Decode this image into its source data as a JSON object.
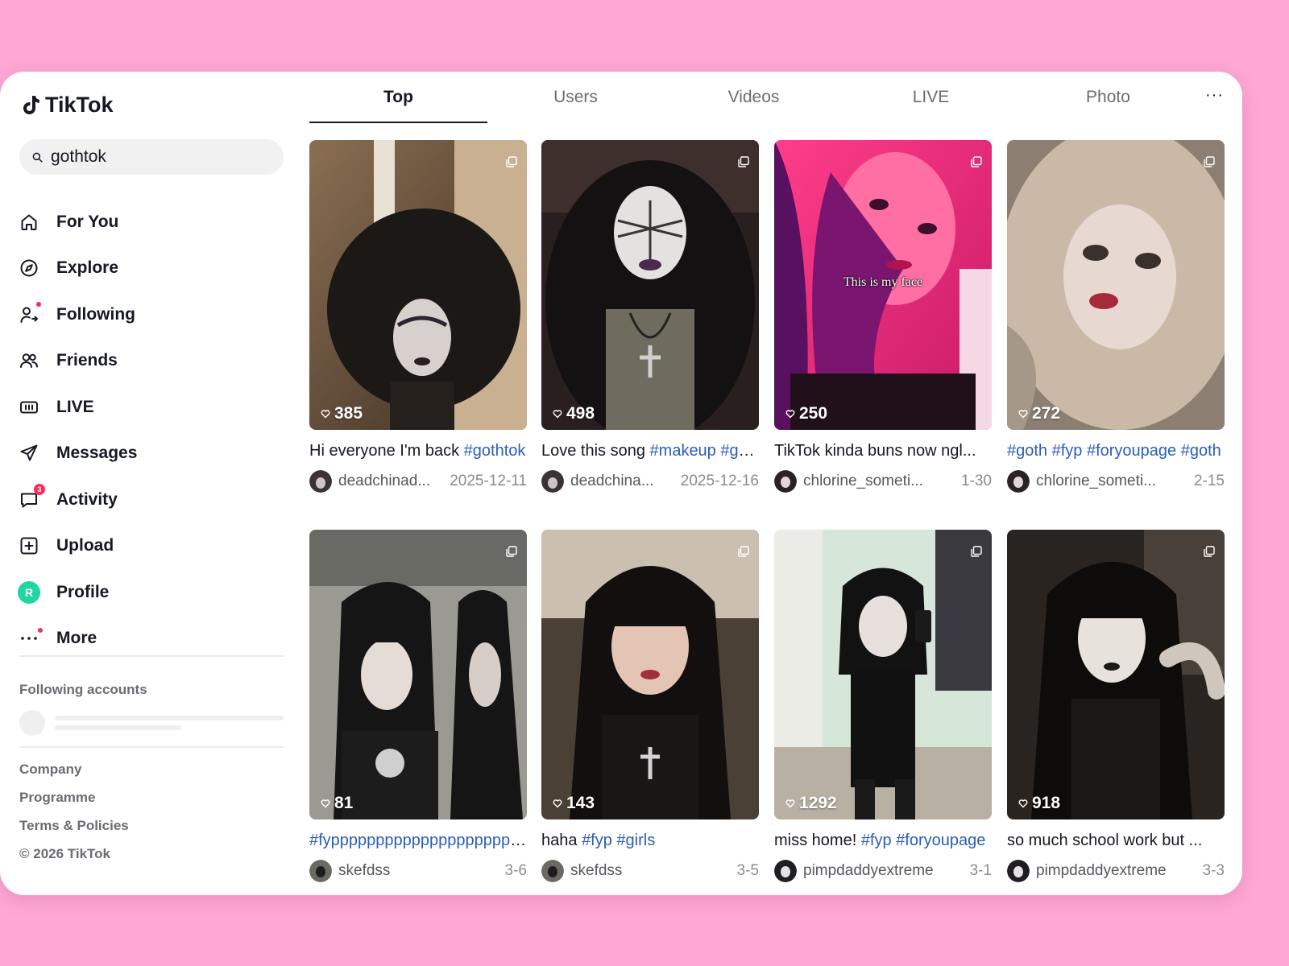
{
  "app": {
    "name": "TikTok"
  },
  "search": {
    "value": "gothtok"
  },
  "nav": [
    {
      "label": "For You",
      "icon": "home-icon"
    },
    {
      "label": "Explore",
      "icon": "compass-icon"
    },
    {
      "label": "Following",
      "icon": "user-follow-icon",
      "dot": true
    },
    {
      "label": "Friends",
      "icon": "friends-icon"
    },
    {
      "label": "LIVE",
      "icon": "live-icon"
    },
    {
      "label": "Messages",
      "icon": "send-icon"
    },
    {
      "label": "Activity",
      "icon": "chat-bubble-icon",
      "badge": "3"
    },
    {
      "label": "Upload",
      "icon": "plus-square-icon"
    },
    {
      "label": "Profile",
      "icon": "avatar",
      "avatar_letter": "R"
    },
    {
      "label": "More",
      "icon": "more-dots-icon",
      "dot": true
    }
  ],
  "following_accounts": {
    "title": "Following accounts"
  },
  "footer": {
    "company": "Company",
    "programme": "Programme",
    "terms": "Terms & Policies",
    "copyright": "© 2026 TikTok"
  },
  "tabs": [
    {
      "label": "Top",
      "active": true
    },
    {
      "label": "Users"
    },
    {
      "label": "Videos"
    },
    {
      "label": "LIVE"
    },
    {
      "label": "Photo"
    }
  ],
  "tabs_more": "···",
  "results": [
    {
      "likes": "385",
      "caption": "Hi everyone I'm back ",
      "tags": "#gothtok",
      "user": "deadchinad...",
      "date": "2025-12-11"
    },
    {
      "likes": "498",
      "caption": "Love this song ",
      "tags": "#makeup #goth",
      "user": "deadchina...",
      "date": "2025-12-16"
    },
    {
      "likes": "250",
      "caption": "TikTok kinda buns now ngl...",
      "tags": "",
      "user": "chlorine_someti...",
      "date": "1-30",
      "overlay": "This is my face"
    },
    {
      "likes": "272",
      "caption": "",
      "tags": "#goth #fyp #foryoupage #goth",
      "user": "chlorine_someti...",
      "date": "2-15"
    },
    {
      "likes": "81",
      "caption": "",
      "tags": "#fypppppppppppppppppppppp",
      "user": "skefdss",
      "date": "3-6"
    },
    {
      "likes": "143",
      "caption": "haha ",
      "tags": "#fyp #girls",
      "user": "skefdss",
      "date": "3-5"
    },
    {
      "likes": "1292",
      "caption": "miss home! ",
      "tags": "#fyp #foryoupage",
      "user": "pimpdaddyextreme",
      "date": "3-1"
    },
    {
      "likes": "918",
      "caption": "so much school work but ...",
      "tags": "",
      "user": "pimpdaddyextreme",
      "date": "3-3"
    }
  ],
  "colors": {
    "background": "#ffa8d6",
    "accent": "#fe2c55",
    "hashtag": "#2b5db9",
    "profile_avatar": "#20d5a0"
  }
}
